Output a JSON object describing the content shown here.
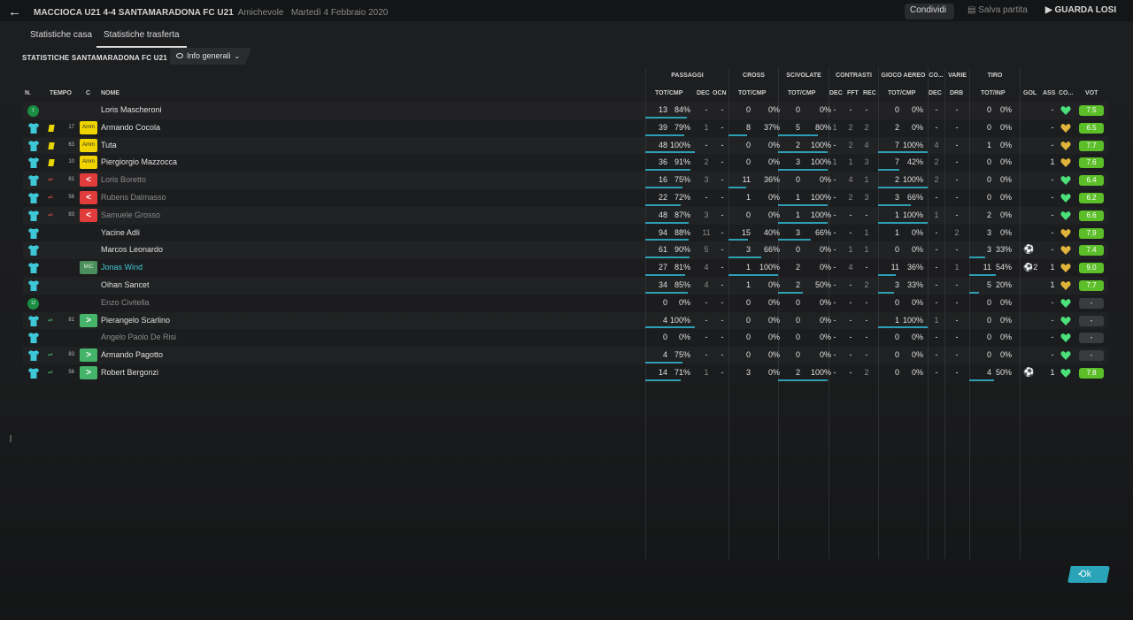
{
  "header": {
    "match": "MACCIOCA U21 4-4 SANTAMARADONA FC U21",
    "type": "Amichevole",
    "date": "Martedì 4 Febbraio 2020",
    "share": "Condividi",
    "save": "Salva partita",
    "play": "GUARDA LOSI"
  },
  "tabs": [
    "Statistiche casa",
    "Statistiche trasferta"
  ],
  "section_title": "STATISTICHE SANTAMARADONA FC U21",
  "view_selector": "Info generali",
  "col_heads": {
    "n": "N.",
    "tempo": "TEMPO",
    "c": "C",
    "nome": "NOME"
  },
  "groups": [
    "PASSAGGI",
    "CROSS",
    "SCIVOLATE",
    "CONTRASTI",
    "GIOCO AEREO",
    "CO...",
    "VARIE",
    "TIRO"
  ],
  "sub_heads": [
    "TOT/CMP",
    "DEC",
    "OCN",
    "TOT/CMP",
    "TOT/CMP",
    "DEC",
    "FFT",
    "REC",
    "TOT/CMP",
    "DEC",
    "DRB",
    "TOT/INP",
    "GOL",
    "ASS",
    "CO...",
    "VOT"
  ],
  "rating_colors": {
    "green": "#5cbf2a",
    "gray": "#3a3b3d"
  },
  "players": [
    {
      "num": "1",
      "gk": true,
      "evt": "",
      "min": "",
      "badge": "",
      "name": "Loris Mascheroni",
      "style": "",
      "pt": "13",
      "pp": "84%",
      "pf": 0.84,
      "pd": "-",
      "po": "-",
      "ct": "0",
      "cp": "0%",
      "cf": 0,
      "st": "0",
      "sp": "0%",
      "sf": 0,
      "td": "-",
      "tf": "-",
      "tr": "-",
      "at": "0",
      "ap": "0%",
      "af": 0,
      "co": "-",
      "dr": "-",
      "tt": "0",
      "tp": "0%",
      "tf2": 0,
      "gol": "",
      "ass": "-",
      "heart": "g",
      "vot": "7.5"
    },
    {
      "num": "",
      "gk": false,
      "evt": "card",
      "min": "17",
      "badge": "Amm",
      "name": "Armando Cocola",
      "style": "",
      "pt": "39",
      "pp": "79%",
      "pf": 0.79,
      "pd": "1",
      "po": "-",
      "ct": "8",
      "cp": "37%",
      "cf": 0.37,
      "st": "5",
      "sp": "80%",
      "sf": 0.8,
      "td": "1",
      "tf": "2",
      "tr": "2",
      "at": "2",
      "ap": "0%",
      "af": 0,
      "co": "-",
      "dr": "-",
      "tt": "0",
      "tp": "0%",
      "tf2": 0,
      "gol": "",
      "ass": "-",
      "heart": "y",
      "vot": "6.5"
    },
    {
      "num": "",
      "gk": false,
      "evt": "card",
      "min": "63",
      "badge": "Amm",
      "name": "Tuta",
      "style": "",
      "pt": "48",
      "pp": "100%",
      "pf": 1,
      "pd": "-",
      "po": "-",
      "ct": "0",
      "cp": "0%",
      "cf": 0,
      "st": "2",
      "sp": "100%",
      "sf": 1,
      "td": "-",
      "tf": "2",
      "tr": "4",
      "at": "7",
      "ap": "100%",
      "af": 1,
      "co": "4",
      "dr": "-",
      "tt": "1",
      "tp": "0%",
      "tf2": 0,
      "gol": "",
      "ass": "-",
      "heart": "y",
      "vot": "7.7"
    },
    {
      "num": "",
      "gk": false,
      "evt": "card",
      "min": "10",
      "badge": "Amm",
      "name": "Piergiorgio Mazzocca",
      "style": "",
      "pt": "36",
      "pp": "91%",
      "pf": 0.91,
      "pd": "2",
      "po": "-",
      "ct": "0",
      "cp": "0%",
      "cf": 0,
      "st": "3",
      "sp": "100%",
      "sf": 1,
      "td": "1",
      "tf": "1",
      "tr": "3",
      "at": "7",
      "ap": "42%",
      "af": 0.42,
      "co": "2",
      "dr": "-",
      "tt": "0",
      "tp": "0%",
      "tf2": 0,
      "gol": "",
      "ass": "1",
      "heart": "y",
      "vot": "7.6"
    },
    {
      "num": "",
      "gk": false,
      "evt": "out",
      "min": "81",
      "badge": "<",
      "name": "Loris Boretto",
      "style": "dim",
      "pt": "16",
      "pp": "75%",
      "pf": 0.75,
      "pd": "3",
      "po": "-",
      "ct": "11",
      "cp": "36%",
      "cf": 0.36,
      "st": "0",
      "sp": "0%",
      "sf": 0,
      "td": "-",
      "tf": "4",
      "tr": "1",
      "at": "2",
      "ap": "100%",
      "af": 1,
      "co": "2",
      "dr": "-",
      "tt": "0",
      "tp": "0%",
      "tf2": 0,
      "gol": "",
      "ass": "-",
      "heart": "g",
      "vot": "6.4"
    },
    {
      "num": "",
      "gk": false,
      "evt": "out",
      "min": "56",
      "badge": "<",
      "name": "Rubens Dalmasso",
      "style": "dim",
      "pt": "22",
      "pp": "72%",
      "pf": 0.72,
      "pd": "-",
      "po": "-",
      "ct": "1",
      "cp": "0%",
      "cf": 0,
      "st": "1",
      "sp": "100%",
      "sf": 1,
      "td": "-",
      "tf": "2",
      "tr": "3",
      "at": "3",
      "ap": "66%",
      "af": 0.66,
      "co": "-",
      "dr": "-",
      "tt": "0",
      "tp": "0%",
      "tf2": 0,
      "gol": "",
      "ass": "-",
      "heart": "g",
      "vot": "6.2"
    },
    {
      "num": "",
      "gk": false,
      "evt": "out",
      "min": "83",
      "badge": "<",
      "name": "Samuele Grosso",
      "style": "dim",
      "pt": "48",
      "pp": "87%",
      "pf": 0.87,
      "pd": "3",
      "po": "-",
      "ct": "0",
      "cp": "0%",
      "cf": 0,
      "st": "1",
      "sp": "100%",
      "sf": 1,
      "td": "-",
      "tf": "-",
      "tr": "-",
      "at": "1",
      "ap": "100%",
      "af": 1,
      "co": "1",
      "dr": "-",
      "tt": "2",
      "tp": "0%",
      "tf2": 0,
      "gol": "",
      "ass": "-",
      "heart": "g",
      "vot": "6.6"
    },
    {
      "num": "",
      "gk": false,
      "evt": "",
      "min": "",
      "badge": "",
      "name": "Yacine Adli",
      "style": "",
      "pt": "94",
      "pp": "88%",
      "pf": 0.88,
      "pd": "11",
      "po": "-",
      "ct": "15",
      "cp": "40%",
      "cf": 0.4,
      "st": "3",
      "sp": "66%",
      "sf": 0.66,
      "td": "-",
      "tf": "-",
      "tr": "1",
      "at": "1",
      "ap": "0%",
      "af": 0,
      "co": "-",
      "dr": "2",
      "tt": "3",
      "tp": "0%",
      "tf2": 0,
      "gol": "",
      "ass": "-",
      "heart": "y",
      "vot": "7.9"
    },
    {
      "num": "",
      "gk": false,
      "evt": "",
      "min": "",
      "badge": "",
      "name": "Marcos Leonardo",
      "style": "",
      "pt": "61",
      "pp": "90%",
      "pf": 0.9,
      "pd": "5",
      "po": "-",
      "ct": "3",
      "cp": "66%",
      "cf": 0.66,
      "st": "0",
      "sp": "0%",
      "sf": 0,
      "td": "-",
      "tf": "1",
      "tr": "1",
      "at": "0",
      "ap": "0%",
      "af": 0,
      "co": "-",
      "dr": "-",
      "tt": "3",
      "tp": "33%",
      "tf2": 0.33,
      "gol": "ball",
      "ass": "-",
      "heart": "y",
      "vot": "7.4"
    },
    {
      "num": "",
      "gk": false,
      "evt": "",
      "min": "",
      "badge": "MiC",
      "name": "Jonas Wind",
      "style": "hl",
      "pt": "27",
      "pp": "81%",
      "pf": 0.81,
      "pd": "4",
      "po": "-",
      "ct": "1",
      "cp": "100%",
      "cf": 1,
      "st": "2",
      "sp": "0%",
      "sf": 0,
      "td": "-",
      "tf": "4",
      "tr": "-",
      "at": "11",
      "ap": "36%",
      "af": 0.36,
      "co": "-",
      "dr": "1",
      "tt": "11",
      "tp": "54%",
      "tf2": 0.54,
      "gol": "ball2",
      "ass": "1",
      "heart": "y",
      "vot": "9.0"
    },
    {
      "num": "",
      "gk": false,
      "evt": "",
      "min": "",
      "badge": "",
      "name": "Oihan Sancet",
      "style": "",
      "pt": "34",
      "pp": "85%",
      "pf": 0.85,
      "pd": "4",
      "po": "-",
      "ct": "1",
      "cp": "0%",
      "cf": 0,
      "st": "2",
      "sp": "50%",
      "sf": 0.5,
      "td": "-",
      "tf": "-",
      "tr": "2",
      "at": "3",
      "ap": "33%",
      "af": 0.33,
      "co": "-",
      "dr": "-",
      "tt": "5",
      "tp": "20%",
      "tf2": 0.2,
      "gol": "",
      "ass": "1",
      "heart": "y",
      "vot": "7.7"
    },
    {
      "num": "12",
      "gk": true,
      "evt": "",
      "min": "",
      "badge": "",
      "name": "Enzo Civitella",
      "style": "dim",
      "pt": "0",
      "pp": "0%",
      "pf": 0,
      "pd": "-",
      "po": "-",
      "ct": "0",
      "cp": "0%",
      "cf": 0,
      "st": "0",
      "sp": "0%",
      "sf": 0,
      "td": "-",
      "tf": "-",
      "tr": "-",
      "at": "0",
      "ap": "0%",
      "af": 0,
      "co": "-",
      "dr": "-",
      "tt": "0",
      "tp": "0%",
      "tf2": 0,
      "gol": "",
      "ass": "-",
      "heart": "g",
      "vot": "-"
    },
    {
      "num": "",
      "gk": false,
      "evt": "in",
      "min": "81",
      "badge": ">",
      "name": "Pierangelo Scarlino",
      "style": "",
      "pt": "4",
      "pp": "100%",
      "pf": 1,
      "pd": "-",
      "po": "-",
      "ct": "0",
      "cp": "0%",
      "cf": 0,
      "st": "0",
      "sp": "0%",
      "sf": 0,
      "td": "-",
      "tf": "-",
      "tr": "-",
      "at": "1",
      "ap": "100%",
      "af": 1,
      "co": "1",
      "dr": "-",
      "tt": "0",
      "tp": "0%",
      "tf2": 0,
      "gol": "",
      "ass": "-",
      "heart": "g",
      "vot": "-"
    },
    {
      "num": "",
      "gk": false,
      "evt": "",
      "min": "",
      "badge": "",
      "name": "Angelo Paolo De Risi",
      "style": "dim",
      "pt": "0",
      "pp": "0%",
      "pf": 0,
      "pd": "-",
      "po": "-",
      "ct": "0",
      "cp": "0%",
      "cf": 0,
      "st": "0",
      "sp": "0%",
      "sf": 0,
      "td": "-",
      "tf": "-",
      "tr": "-",
      "at": "0",
      "ap": "0%",
      "af": 0,
      "co": "-",
      "dr": "-",
      "tt": "0",
      "tp": "0%",
      "tf2": 0,
      "gol": "",
      "ass": "-",
      "heart": "g",
      "vot": "-"
    },
    {
      "num": "",
      "gk": false,
      "evt": "in",
      "min": "83",
      "badge": ">",
      "name": "Armando Pagotto",
      "style": "",
      "pt": "4",
      "pp": "75%",
      "pf": 0.75,
      "pd": "-",
      "po": "-",
      "ct": "0",
      "cp": "0%",
      "cf": 0,
      "st": "0",
      "sp": "0%",
      "sf": 0,
      "td": "-",
      "tf": "-",
      "tr": "-",
      "at": "0",
      "ap": "0%",
      "af": 0,
      "co": "-",
      "dr": "-",
      "tt": "0",
      "tp": "0%",
      "tf2": 0,
      "gol": "",
      "ass": "-",
      "heart": "g",
      "vot": "-"
    },
    {
      "num": "",
      "gk": false,
      "evt": "in",
      "min": "56",
      "badge": ">",
      "name": "Robert Bergonzi",
      "style": "",
      "pt": "14",
      "pp": "71%",
      "pf": 0.71,
      "pd": "1",
      "po": "-",
      "ct": "3",
      "cp": "0%",
      "cf": 0,
      "st": "2",
      "sp": "100%",
      "sf": 1,
      "td": "-",
      "tf": "-",
      "tr": "2",
      "at": "0",
      "ap": "0%",
      "af": 0,
      "co": "-",
      "dr": "-",
      "tt": "4",
      "tp": "50%",
      "tf2": 0.5,
      "gol": "ball",
      "ass": "1",
      "heart": "g",
      "vot": "7.8"
    }
  ],
  "ok_label": "Ok"
}
